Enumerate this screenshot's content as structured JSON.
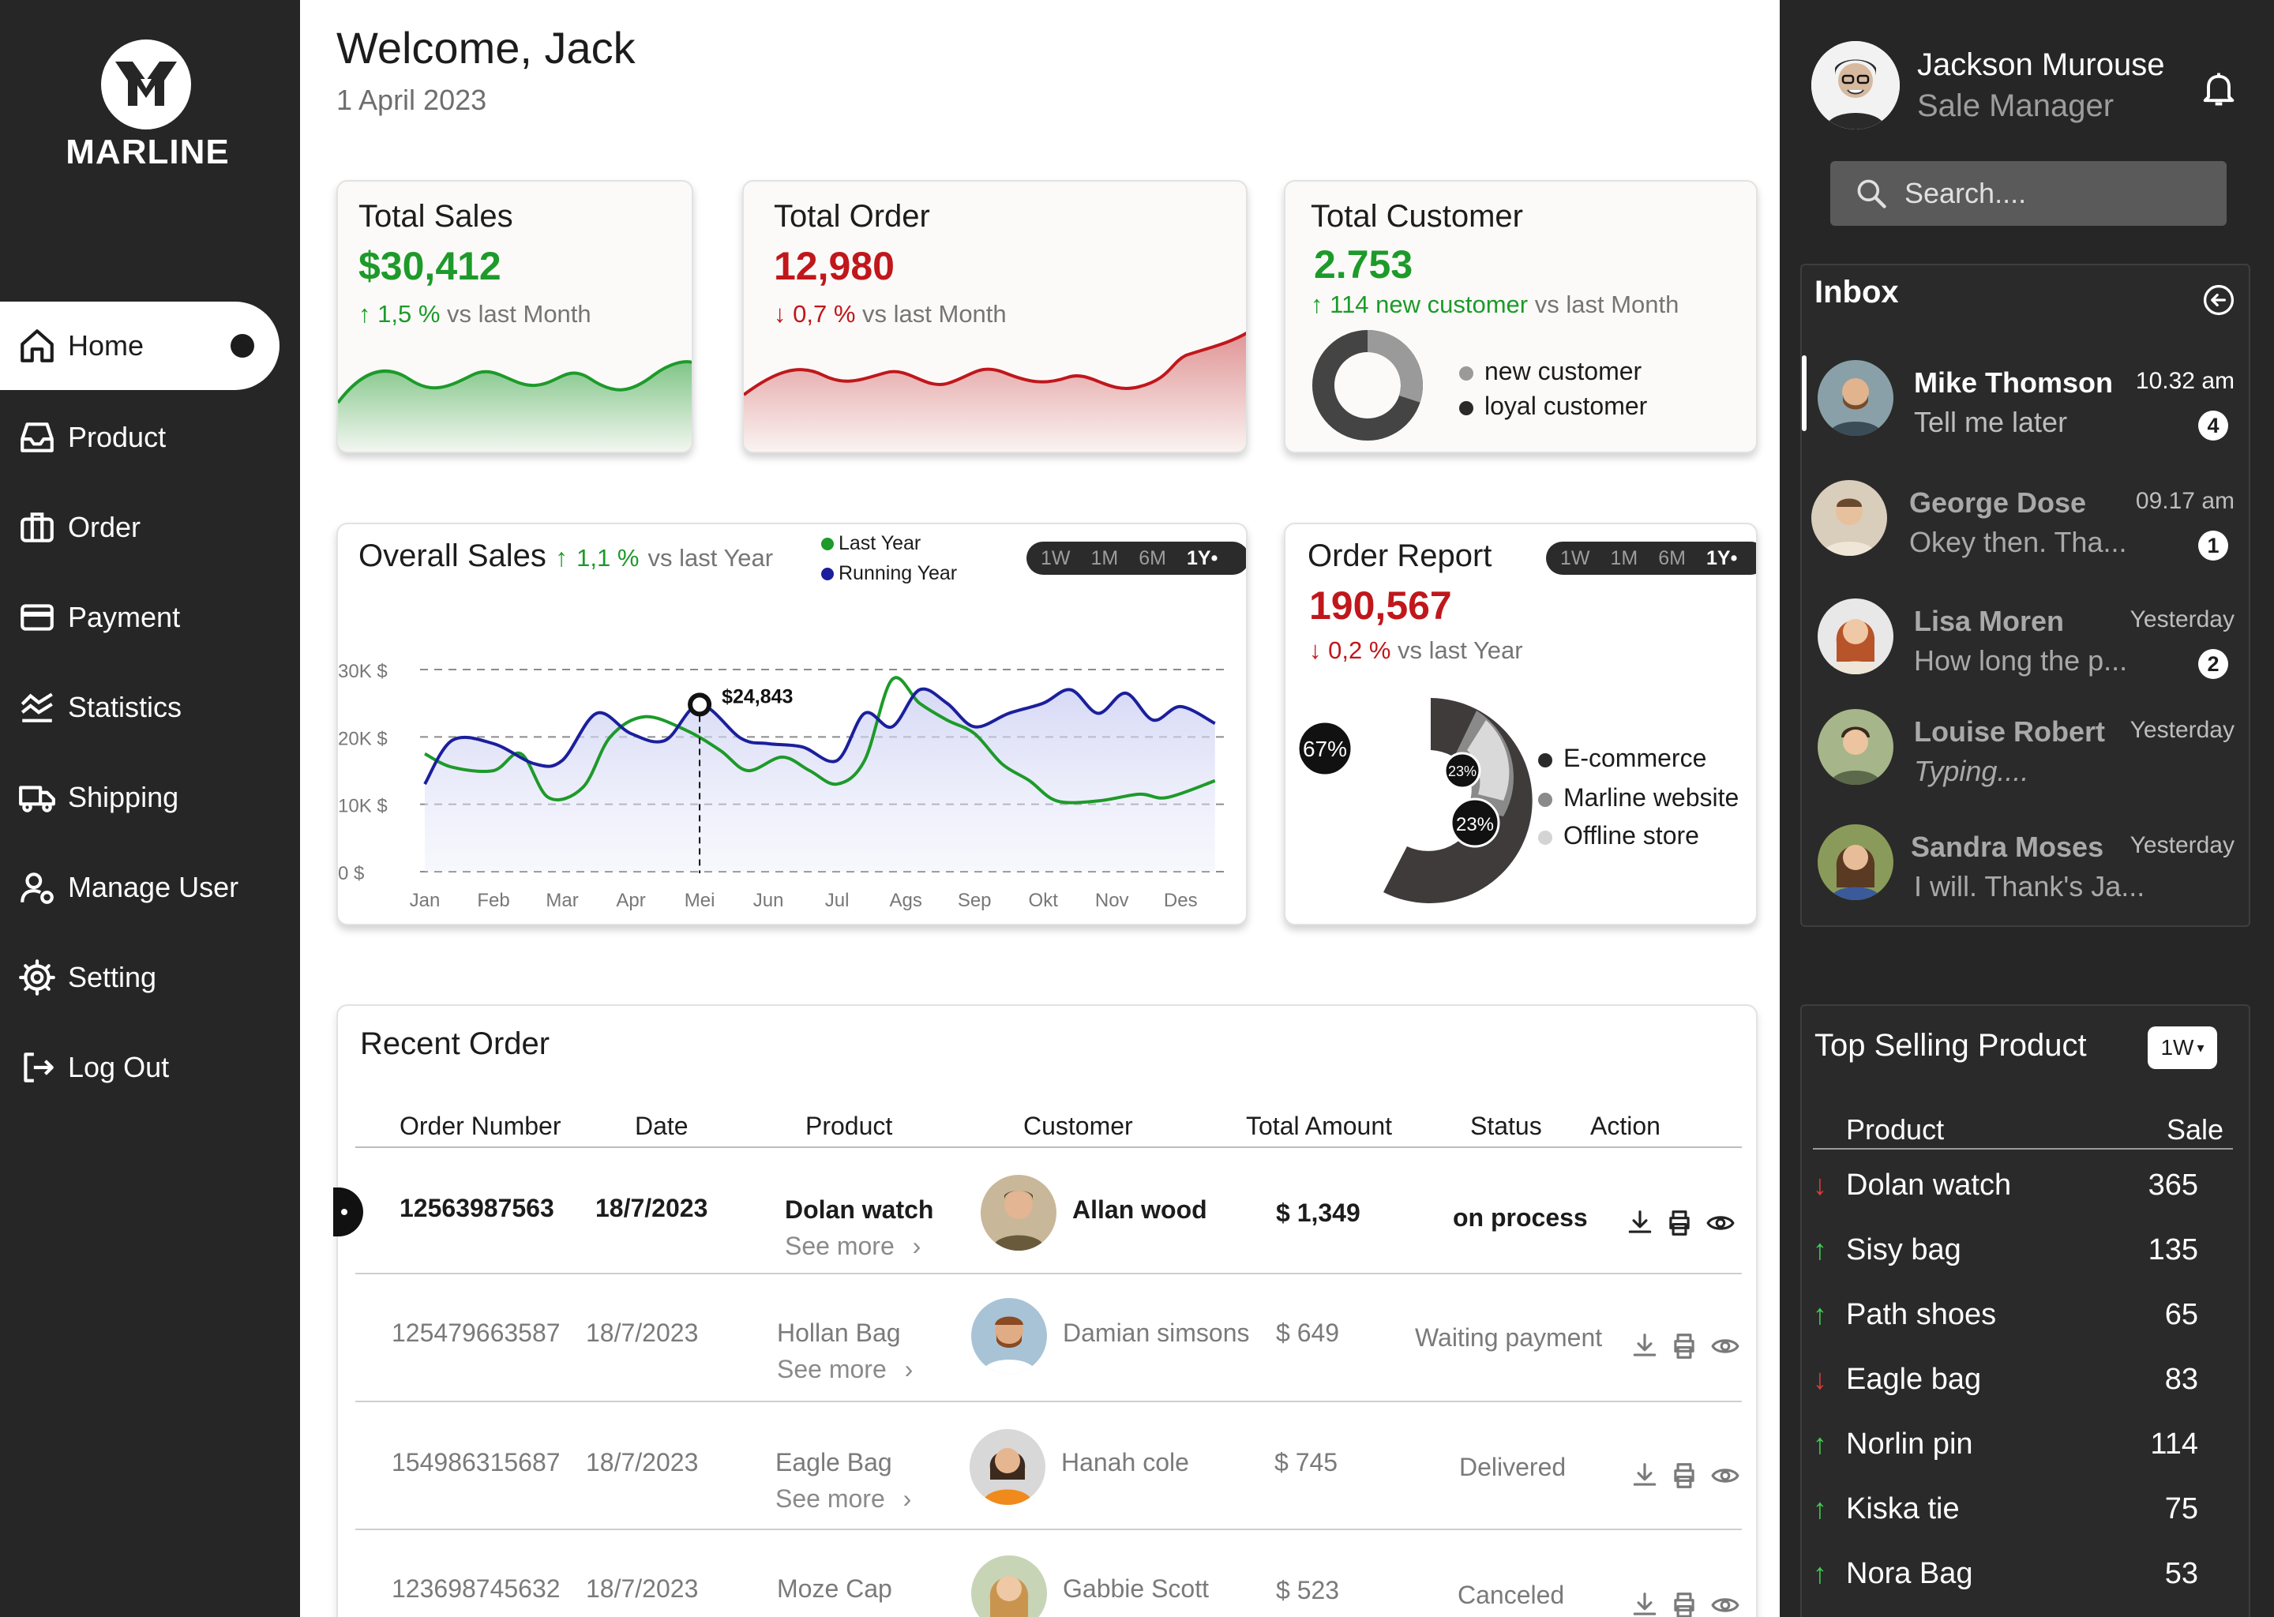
{
  "app": {
    "brand": "MARLINE"
  },
  "nav": {
    "items": [
      {
        "label": "Home",
        "icon": "home-icon"
      },
      {
        "label": "Product",
        "icon": "inbox-tray-icon"
      },
      {
        "label": "Order",
        "icon": "briefcase-icon"
      },
      {
        "label": "Payment",
        "icon": "credit-card-icon"
      },
      {
        "label": "Statistics",
        "icon": "chart-wave-icon"
      },
      {
        "label": "Shipping",
        "icon": "truck-icon"
      },
      {
        "label": "Manage User",
        "icon": "user-gear-icon"
      },
      {
        "label": "Setting",
        "icon": "gear-icon"
      },
      {
        "label": "Log Out",
        "icon": "logout-icon"
      }
    ],
    "active": "Home"
  },
  "header": {
    "welcome": "Welcome, Jack",
    "date": "1 April 2023"
  },
  "cards": {
    "total_sales": {
      "title": "Total Sales",
      "value": "$30,412",
      "delta": "1,5 %",
      "delta_suffix": "vs last Month",
      "trend": "up",
      "color": "#1d9a2a"
    },
    "total_order": {
      "title": "Total Order",
      "value": "12,980",
      "delta": "0,7 %",
      "delta_suffix": "vs last Month",
      "trend": "down",
      "color": "#c0171c"
    },
    "total_customer": {
      "title": "Total Customer",
      "value": "2.753",
      "delta": "114 new customer",
      "delta_suffix": "vs last Month",
      "trend": "up",
      "legend": [
        "new customer",
        "loyal customer"
      ],
      "donut": {
        "new_customer_fraction": 0.3,
        "loyal_customer_fraction": 0.7
      }
    }
  },
  "overall_sales": {
    "title": "Overall Sales",
    "delta": "1,1 %",
    "delta_suffix": "vs last Year",
    "legend": [
      {
        "name": "Last Year",
        "color": "#1d9a2a"
      },
      {
        "name": "Running Year",
        "color": "#1b1f9c"
      }
    ],
    "ranges": [
      "1W",
      "1M",
      "6M",
      "1Y"
    ],
    "active_range": "1Y",
    "tooltip": "$24,843"
  },
  "order_report": {
    "title": "Order Report",
    "value": "190,567",
    "delta": "0,2 %",
    "delta_suffix": "vs last Year",
    "trend": "down",
    "ranges": [
      "1W",
      "1M",
      "6M",
      "1Y"
    ],
    "active_range": "1Y",
    "labels": [
      "67%",
      "23%",
      "23%"
    ],
    "legend": [
      {
        "name": "E-commerce",
        "color": "#2a2a2a"
      },
      {
        "name": "Marline website",
        "color": "#8a8a8a"
      },
      {
        "name": "Offline store",
        "color": "#d4d4d4"
      }
    ]
  },
  "chart_data": {
    "type": "line",
    "title": "Overall Sales",
    "x": [
      "Jan",
      "Feb",
      "Mar",
      "Apr",
      "Mei",
      "Jun",
      "Jul",
      "Ags",
      "Sep",
      "Okt",
      "Nov",
      "Des"
    ],
    "ylim": [
      0,
      30000
    ],
    "yticks": [
      "0 $",
      "10K $",
      "20K $",
      "30K $"
    ],
    "grid": true,
    "legend_placement": "top",
    "series": [
      {
        "name": "Running Year",
        "color": "#1b1f9c",
        "points": [
          [
            0,
            13000
          ],
          [
            0.4,
            19500
          ],
          [
            1,
            19000
          ],
          [
            1.6,
            16000
          ],
          [
            2,
            16500
          ],
          [
            2.5,
            23500
          ],
          [
            3,
            20500
          ],
          [
            3.5,
            19500
          ],
          [
            4,
            24800
          ],
          [
            4.6,
            19800
          ],
          [
            5,
            19000
          ],
          [
            5.5,
            18500
          ],
          [
            6,
            16500
          ],
          [
            6.4,
            23500
          ],
          [
            6.8,
            21500
          ],
          [
            7.2,
            27000
          ],
          [
            7.6,
            25000
          ],
          [
            8,
            21500
          ],
          [
            8.5,
            23500
          ],
          [
            9,
            25000
          ],
          [
            9.4,
            27000
          ],
          [
            9.8,
            23500
          ],
          [
            10.2,
            26500
          ],
          [
            10.6,
            22500
          ],
          [
            11,
            24500
          ],
          [
            11.5,
            22000
          ]
        ]
      },
      {
        "name": "Last Year",
        "color": "#1d9a2a",
        "points": [
          [
            0,
            17500
          ],
          [
            0.4,
            15500
          ],
          [
            1,
            15000
          ],
          [
            1.4,
            17500
          ],
          [
            1.8,
            11000
          ],
          [
            2.3,
            12500
          ],
          [
            2.7,
            20000
          ],
          [
            3.2,
            23000
          ],
          [
            3.8,
            21000
          ],
          [
            4.3,
            18000
          ],
          [
            4.7,
            15000
          ],
          [
            5.2,
            17000
          ],
          [
            5.6,
            15000
          ],
          [
            6,
            13000
          ],
          [
            6.4,
            16500
          ],
          [
            6.8,
            28500
          ],
          [
            7.2,
            25000
          ],
          [
            7.6,
            22500
          ],
          [
            8,
            20500
          ],
          [
            8.4,
            16000
          ],
          [
            8.8,
            13500
          ],
          [
            9.2,
            10500
          ],
          [
            9.8,
            10500
          ],
          [
            10.4,
            11500
          ],
          [
            10.8,
            11000
          ],
          [
            11.5,
            13500
          ]
        ]
      }
    ]
  },
  "recent_order": {
    "title": "Recent Order",
    "columns": [
      "Order Number",
      "Date",
      "Product",
      "Customer",
      "Total Amount",
      "Status",
      "Action"
    ],
    "see_more": "See more",
    "rows": [
      {
        "order": "12563987563",
        "date": "18/7/2023",
        "product": "Dolan watch",
        "customer": "Allan wood",
        "amount": "$ 1,349",
        "status": "on process",
        "highlight": true
      },
      {
        "order": "125479663587",
        "date": "18/7/2023",
        "product": "Hollan Bag",
        "customer": "Damian simsons",
        "amount": "$ 649",
        "status": "Waiting payment",
        "highlight": false
      },
      {
        "order": "154986315687",
        "date": "18/7/2023",
        "product": "Eagle Bag",
        "customer": "Hanah cole",
        "amount": "$ 745",
        "status": "Delivered",
        "highlight": false
      },
      {
        "order": "123698745632",
        "date": "18/7/2023",
        "product": "Moze Cap",
        "customer": "Gabbie Scott",
        "amount": "$ 523",
        "status": "Canceled",
        "highlight": false
      }
    ]
  },
  "profile": {
    "name": "Jackson Murouse",
    "role": "Sale Manager"
  },
  "search": {
    "placeholder": "Search...."
  },
  "inbox": {
    "title": "Inbox",
    "messages": [
      {
        "name": "Mike Thomson",
        "text": "Tell me later",
        "time": "10.32 am",
        "badge": "4",
        "active": true
      },
      {
        "name": "George Dose",
        "text": "Okey then. Tha...",
        "time": "09.17 am",
        "badge": "1",
        "active": false
      },
      {
        "name": "Lisa Moren",
        "text": "How long the p...",
        "time": "Yesterday",
        "badge": "2",
        "active": false
      },
      {
        "name": "Louise Robert",
        "text": "Typing....",
        "time": "Yesterday",
        "badge": "",
        "active": false
      },
      {
        "name": "Sandra Moses",
        "text": "I will. Thank's Ja...",
        "time": "Yesterday",
        "badge": "",
        "active": false
      }
    ]
  },
  "top_selling": {
    "title": "Top Selling Product",
    "range": "1W",
    "col_product": "Product",
    "col_sale": "Sale",
    "items": [
      {
        "name": "Dolan watch",
        "sale": "365",
        "trend": "down"
      },
      {
        "name": "Sisy  bag",
        "sale": "135",
        "trend": "up"
      },
      {
        "name": "Path shoes",
        "sale": "65",
        "trend": "up"
      },
      {
        "name": "Eagle bag",
        "sale": "83",
        "trend": "down"
      },
      {
        "name": "Norlin  pin",
        "sale": "114",
        "trend": "up"
      },
      {
        "name": "Kiska tie",
        "sale": "75",
        "trend": "up"
      },
      {
        "name": "Nora Bag",
        "sale": "53",
        "trend": "up"
      }
    ]
  }
}
